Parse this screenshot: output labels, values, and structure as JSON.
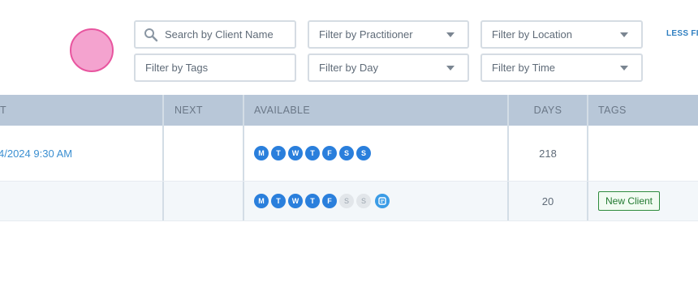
{
  "filters": {
    "search_placeholder": "Search by Client Name",
    "practitioner": "Filter by Practitioner",
    "location": "Filter by Location",
    "tags": "Filter by Tags",
    "day": "Filter by Day",
    "time": "Filter by Time",
    "less_filters": "LESS FI"
  },
  "table": {
    "headers": {
      "last": "T",
      "next": "NEXT",
      "available": "AVAILABLE",
      "days": "DAYS",
      "tags": "TAGS"
    },
    "rows": [
      {
        "last": "4/2024 9:30 AM",
        "next": "",
        "days_count": "218",
        "tag": "",
        "availability": [
          {
            "letter": "M",
            "on": true
          },
          {
            "letter": "T",
            "on": true
          },
          {
            "letter": "W",
            "on": true
          },
          {
            "letter": "T",
            "on": true
          },
          {
            "letter": "F",
            "on": true
          },
          {
            "letter": "S",
            "on": true
          },
          {
            "letter": "S",
            "on": true
          }
        ]
      },
      {
        "last": "",
        "next": "",
        "days_count": "20",
        "tag": "New Client",
        "availability": [
          {
            "letter": "M",
            "on": true
          },
          {
            "letter": "T",
            "on": true
          },
          {
            "letter": "W",
            "on": true
          },
          {
            "letter": "T",
            "on": true
          },
          {
            "letter": "F",
            "on": true
          },
          {
            "letter": "S",
            "on": false
          },
          {
            "letter": "S",
            "on": false
          }
        ]
      }
    ]
  },
  "colors": {
    "accent": "#2a7fdc",
    "header_bg": "#b8c7d8",
    "tag_green": "#2e8b3d",
    "cursor_pink": "#f4a3cf"
  }
}
